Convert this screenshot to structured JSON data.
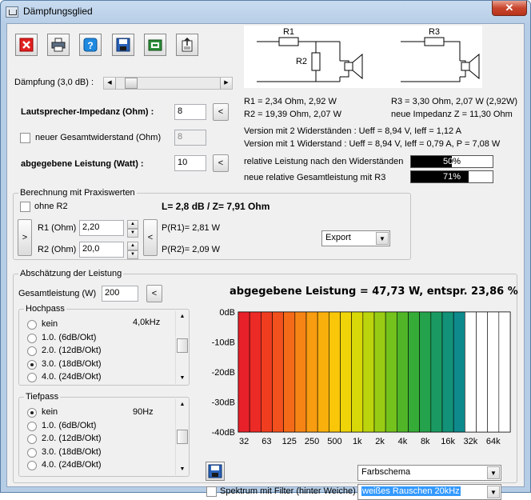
{
  "window": {
    "title": "Dämpfungsglied",
    "close_label": "✕"
  },
  "toolbar": {
    "icons": [
      "close-red-icon",
      "print-icon",
      "help-icon",
      "save-icon",
      "open-folder-icon",
      "export-icon"
    ]
  },
  "circuit": {
    "r1": "R1",
    "r2": "R2",
    "r3": "R3"
  },
  "daempfung": {
    "label": "Dämpfung (3,0 dB) :",
    "slider_fraction": 0.1
  },
  "results": {
    "r1": "R1 = 2,34 Ohm, 2,92 W",
    "r2": "R2 = 19,39 Ohm, 2,07 W",
    "r3": "R3 = 3,30 Ohm, 2,07 W (2,92W)",
    "neue_impedanz": "neue Impedanz Z = 11,30 Ohm",
    "version2": "Version mit 2 Widerständen : Ueff = 8,94 V, Ieff = 1,12 A",
    "version1": "Version mit 1 Widerstand : Ueff = 8,94 V, Ieff = 0,79 A, P = 7,08 W",
    "rel_leistung_label": "relative Leistung nach den Widerständen",
    "rel_leistung_value": "50%",
    "rel_leistung_fraction": 0.5,
    "rel_gesamt_label": "neue relative Gesamtleistung mit R3",
    "rel_gesamt_value": "71%",
    "rel_gesamt_fraction": 0.71
  },
  "impedanz": {
    "label": "Lautsprecher-Impedanz (Ohm) :",
    "value": "8",
    "btn": "<"
  },
  "gesamtwiderstand": {
    "label": "neuer Gesamtwiderstand (Ohm)",
    "value": "8",
    "checked": false
  },
  "leistung": {
    "label": "abgegebene Leistung (Watt) :",
    "value": "10",
    "btn": "<"
  },
  "praxis": {
    "title": "Berechnung mit Praxiswerten",
    "ohne_r2": "ohne R2",
    "summary": "L= 2,8 dB / Z= 7,91 Ohm",
    "r1_label": "R1 (Ohm)",
    "r1_value": "2,20",
    "r2_label": "R2 (Ohm)",
    "r2_value": "20,0",
    "p_r1": "P(R1)= 2,81 W",
    "p_r2": "P(R2)= 2,09 W",
    "left_btn": ">",
    "right_btn": "<",
    "export": "Export"
  },
  "abschaetzung": {
    "title": "Abschätzung der Leistung",
    "gesamt_label": "Gesamtleistung (W)",
    "gesamt_value": "200",
    "gesamt_btn": "<",
    "headline": "abgegebene Leistung = 47,73 W, entspr. 23,86 %",
    "hochpass": {
      "title": "Hochpass",
      "freq": "4,0kHz",
      "options": [
        "kein",
        "1.0. (6dB/Okt)",
        "2.0. (12dB/Okt)",
        "3.0. (18dB/Okt)",
        "4.0. (24dB/Okt)"
      ],
      "selected": 3
    },
    "tiefpass": {
      "title": "Tiefpass",
      "freq": "90Hz",
      "options": [
        "kein",
        "1.0. (6dB/Okt)",
        "2.0. (12dB/Okt)",
        "3.0. (18dB/Okt)",
        "4.0. (24dB/Okt)"
      ],
      "selected": 0
    },
    "farbschema": "Farbschema",
    "spektrum_label": "Spektrum mit Filter (hinter Weiche)",
    "rauschen": "weißes Rauschen 20kHz"
  },
  "chart_data": {
    "type": "bar",
    "title": "",
    "y_tick_labels": [
      "0dB",
      "-10dB",
      "-20dB",
      "-30dB",
      "-40dB"
    ],
    "ylim": [
      -40,
      0
    ],
    "x_tick_labels": [
      "32",
      "63",
      "125",
      "250",
      "500",
      "1k",
      "2k",
      "4k",
      "8k",
      "16k",
      "32k",
      "64k"
    ],
    "bar_count": 24,
    "values": [
      0,
      0,
      0,
      0,
      0,
      0,
      0,
      0,
      0,
      0,
      0,
      0,
      0,
      0,
      0,
      0,
      0,
      0,
      0,
      0,
      0,
      0,
      0,
      0
    ],
    "colors": [
      "#e8202a",
      "#ec2a26",
      "#f03d20",
      "#f2501c",
      "#f46a18",
      "#f68414",
      "#f89c10",
      "#fab00c",
      "#f9c60a",
      "#eed408",
      "#d8d808",
      "#bcd40c",
      "#98cc14",
      "#74c21c",
      "#50b628",
      "#36ac38",
      "#24a24c",
      "#1a9a62",
      "#129278",
      "#0e8a8c",
      "#ffffff",
      "#ffffff",
      "#ffffff",
      "#ffffff"
    ]
  }
}
